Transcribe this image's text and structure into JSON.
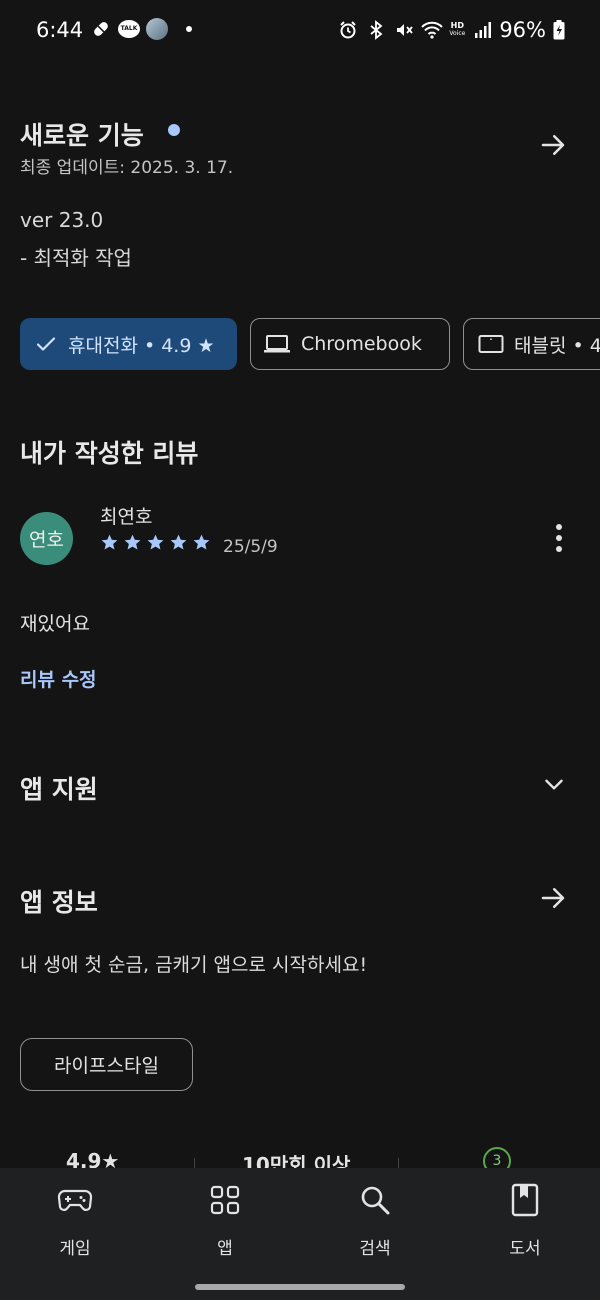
{
  "status_bar": {
    "time": "6:44",
    "talk_label": "TALK",
    "hd_label": "HD",
    "voice_label": "Voice",
    "battery": "96%"
  },
  "whats_new": {
    "title": "새로운 기능",
    "updated": "최종 업데이트: 2025. 3. 17.",
    "version": "ver 23.0",
    "notes": "- 최적화 작업"
  },
  "device_chips": [
    {
      "label": "휴대전화 • 4.9 ★",
      "selected": true,
      "icon": "check-icon"
    },
    {
      "label": "Chromebook",
      "selected": false,
      "icon": "laptop-icon"
    },
    {
      "label": "태블릿 • 4",
      "selected": false,
      "icon": "tablet-icon"
    }
  ],
  "my_review": {
    "heading": "내가 작성한 리뷰",
    "avatar_text": "연호",
    "reviewer": "최연호",
    "stars": 5,
    "date": "25/5/9",
    "body": "재있어요",
    "edit_label": "리뷰 수정"
  },
  "app_support": {
    "title": "앱 지원"
  },
  "about": {
    "title": "앱 정보",
    "description": "내 생애 첫 순금, 금캐기 앱으로 시작하세요!",
    "category": "라이프스타일"
  },
  "stats": {
    "rating": "4.9★",
    "downloads": "10만회 이상",
    "age_rating": "3"
  },
  "bottom_nav": [
    {
      "label": "게임",
      "icon": "gamepad-icon"
    },
    {
      "label": "앱",
      "icon": "apps-grid-icon"
    },
    {
      "label": "검색",
      "icon": "search-icon"
    },
    {
      "label": "도서",
      "icon": "book-icon"
    }
  ],
  "colors": {
    "background": "#141414",
    "accent": "#a8c7fa",
    "selected_chip": "#1e4a7a",
    "avatar": "#3a8d7a",
    "nav_background": "#1f2022"
  }
}
